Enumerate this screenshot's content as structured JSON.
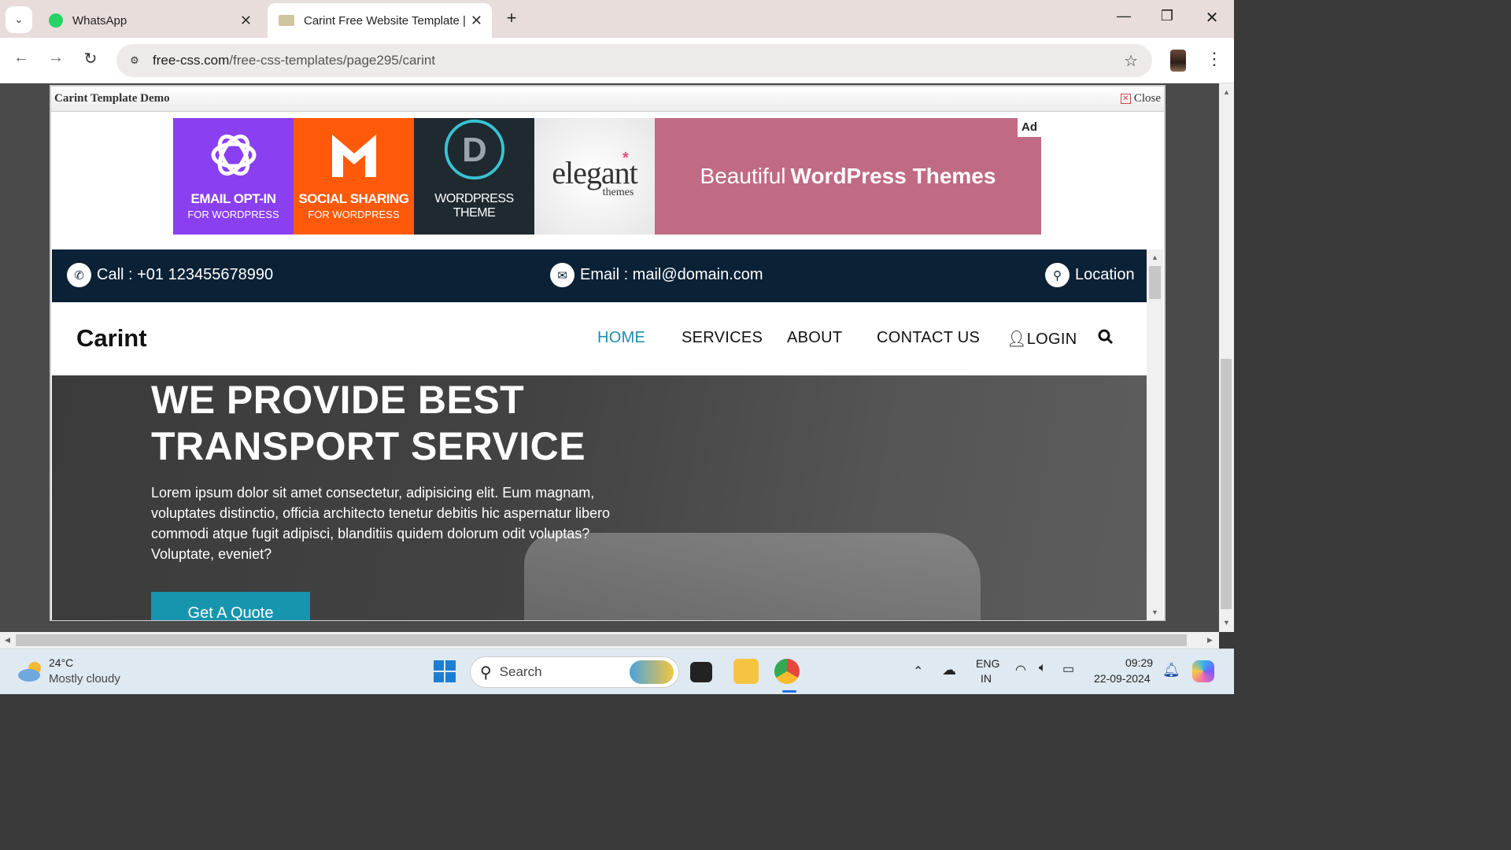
{
  "browser": {
    "tabs": [
      {
        "title": "WhatsApp"
      },
      {
        "title": "Carint Free Website Template | F"
      }
    ],
    "url_host": "free-css.com",
    "url_path": "/free-css-templates/page295/carint"
  },
  "modal": {
    "title": "Carint Template Demo",
    "close_label": "Close"
  },
  "ad": {
    "tiles": [
      {
        "big": "EMAIL OPT-IN",
        "small": "FOR WORDPRESS",
        "color": "#8a3ff0"
      },
      {
        "big": "SOCIAL SHARING",
        "small": "FOR WORDPRESS",
        "color": "#ff5a0a"
      },
      {
        "big": "WORDPRESS THEME",
        "small": "",
        "color": "#1f2a30"
      },
      {
        "big": "elegant",
        "small": "themes",
        "color": "#f2f2f2"
      }
    ],
    "banner_text": "Beautiful",
    "banner_bold": "WordPress Themes",
    "ad_label": "Ad"
  },
  "site": {
    "call": "Call : +01 123455678990",
    "email": "Email : mail@domain.com",
    "location": "Location",
    "brand": "Carint",
    "nav": [
      "HOME",
      "SERVICES",
      "ABOUT",
      "CONTACT US",
      "LOGIN"
    ],
    "hero_title_1": "WE PROVIDE BEST",
    "hero_title_2": "TRANSPORT SERVICE",
    "hero_text": "Lorem ipsum dolor sit amet consectetur, adipisicing elit. Eum magnam, voluptates distinctio, officia architecto tenetur debitis hic aspernatur libero commodi atque fugit adipisci, blanditiis quidem dolorum odit voluptas? Voluptate, eveniet?",
    "cta": "Get A Quote",
    "accent": "#1795ae",
    "topbar_color": "#0b2136"
  },
  "taskbar": {
    "temp": "24°C",
    "weather": "Mostly cloudy",
    "search": "Search",
    "lang1": "ENG",
    "lang2": "IN",
    "time": "09:29",
    "date": "22-09-2024"
  }
}
